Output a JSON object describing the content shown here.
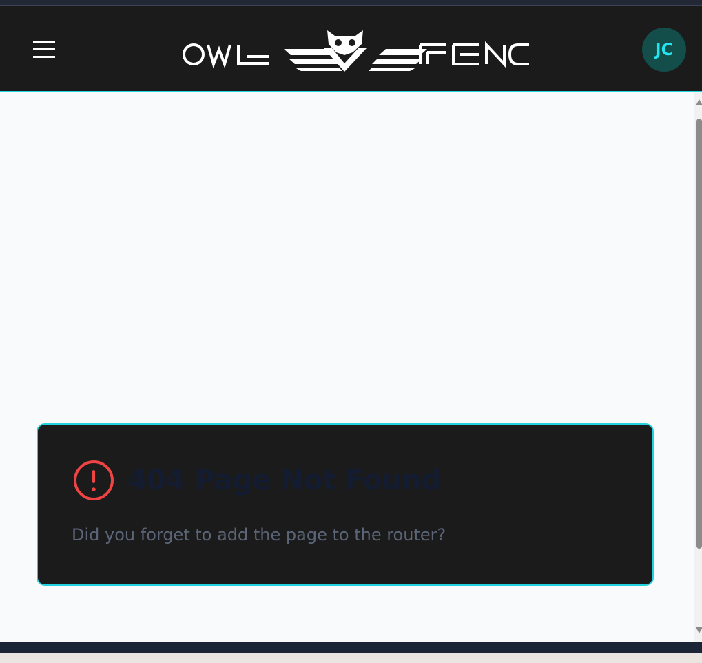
{
  "header": {
    "logo_text": "OWL FENC",
    "avatar_initials": "JC"
  },
  "not_found": {
    "title": "404 Page Not Found",
    "message": "Did you forget to add the page to the router?"
  },
  "icons": {
    "menu": "menu-icon",
    "owl": "owl-icon",
    "alert": "alert-circle-icon"
  },
  "colors": {
    "header_bg": "#1b1b1b",
    "accent": "#22d3df",
    "avatar_bg": "#134e4a",
    "avatar_text": "#22e5ef",
    "alert": "#ef4444",
    "page_bg": "#f8fafc",
    "title_text": "#131c31",
    "message_text": "#5b6577"
  }
}
